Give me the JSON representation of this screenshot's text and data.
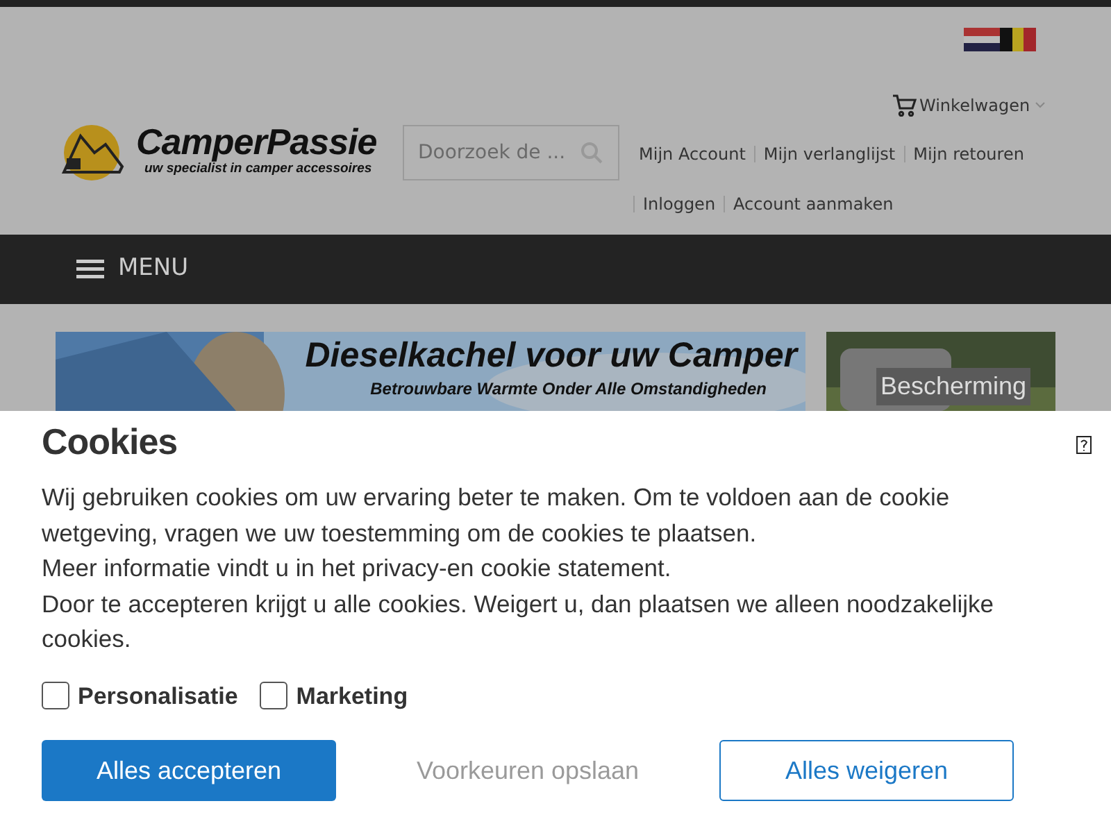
{
  "header": {
    "logo": {
      "name": "CamperPassie",
      "tagline": "uw specialist in camper accessoires"
    },
    "search": {
      "placeholder": "Doorzoek de ..."
    },
    "cart": {
      "label": "Winkelwagen"
    },
    "account_links": [
      "Mijn Account",
      "Mijn verlanglijst",
      "Mijn retouren"
    ],
    "auth_links": [
      "Inloggen",
      "Account aanmaken"
    ]
  },
  "nav": {
    "menu_label": "MENU"
  },
  "banners": [
    {
      "title": "Dieselkachel voor uw Camper",
      "subtitle": "Betrouwbare Warmte Onder Alle Omstandigheden"
    },
    {
      "caption": "Bescherming"
    }
  ],
  "cookie_dialog": {
    "title": "Cookies",
    "paragraphs": [
      "Wij gebruiken cookies om uw ervaring beter te maken. Om te voldoen aan de cookie wetgeving, vragen we uw toestemming om de cookies te plaatsen.",
      "Meer informatie vindt u in het privacy-en cookie statement.",
      "Door te accepteren krijgt u alle cookies. Weigert u, dan plaatsen we alleen noodzakelijke cookies."
    ],
    "options": [
      {
        "label": "Personalisatie",
        "checked": false
      },
      {
        "label": "Marketing",
        "checked": false
      }
    ],
    "buttons": [
      {
        "label": "Alles accepteren",
        "kind": "primary"
      },
      {
        "label": "Voorkeuren opslaan",
        "kind": "plain"
      },
      {
        "label": "Alles weigeren",
        "kind": "outline"
      }
    ]
  }
}
